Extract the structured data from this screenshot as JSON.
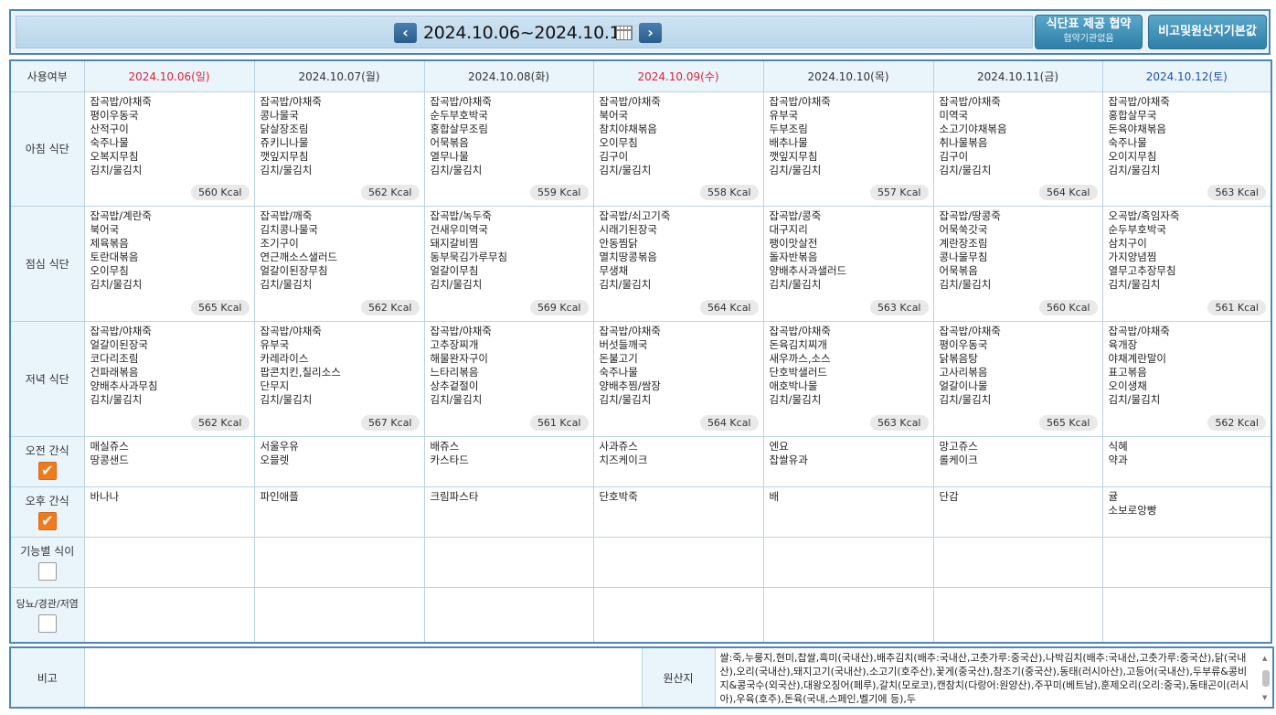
{
  "header": {
    "date_range": "2024.10.06~2024.10.12",
    "prev_label": "‹",
    "next_label": "›",
    "btn_agreement_l1": "식단표 제공 협약",
    "btn_agreement_l2": "협약기관없음",
    "btn_remarks": "비고및원산지기본값"
  },
  "table": {
    "corner": "사용여부",
    "days": [
      {
        "date": "2024.10.06(일)",
        "kind": "sun"
      },
      {
        "date": "2024.10.07(월)",
        "kind": "wd"
      },
      {
        "date": "2024.10.08(화)",
        "kind": "wd"
      },
      {
        "date": "2024.10.09(수)",
        "kind": "hol"
      },
      {
        "date": "2024.10.10(목)",
        "kind": "wd"
      },
      {
        "date": "2024.10.11(금)",
        "kind": "wd"
      },
      {
        "date": "2024.10.12(토)",
        "kind": "sat"
      }
    ],
    "rows": [
      {
        "label": "아침 식단",
        "checkbox": null,
        "cells": [
          {
            "items": [
              "잡곡밥/야채죽",
              "평이우동국",
              "산적구이",
              "숙주나물",
              "오복지무침",
              "김치/물김치"
            ],
            "kcal": "560 Kcal"
          },
          {
            "items": [
              "잡곡밥/야채죽",
              "콩나물국",
              "닭살장조림",
              "쥬키니나물",
              "깻잎지무침",
              "김치/물김치"
            ],
            "kcal": "562 Kcal"
          },
          {
            "items": [
              "잡곡밥/야채죽",
              "순두부호박국",
              "홍합살무조림",
              "어묵볶음",
              "열무나물",
              "김치/물김치"
            ],
            "kcal": "559 Kcal"
          },
          {
            "items": [
              "잡곡밥/야채죽",
              "북어국",
              "참치야채볶음",
              "오이무침",
              "김구이",
              "김치/물김치"
            ],
            "kcal": "558 Kcal"
          },
          {
            "items": [
              "잡곡밥/야채죽",
              "유부국",
              "두부조림",
              "배추나물",
              "깻잎지무침",
              "김치/물김치"
            ],
            "kcal": "557 Kcal"
          },
          {
            "items": [
              "잡곡밥/야채죽",
              "미역국",
              "소고기야채볶음",
              "취나물볶음",
              "김구이",
              "김치/물김치"
            ],
            "kcal": "564 Kcal"
          },
          {
            "items": [
              "잡곡밥/야채죽",
              "홍합살무국",
              "돈육야채볶음",
              "숙주나물",
              "오이지무침",
              "김치/물김치"
            ],
            "kcal": "563 Kcal"
          }
        ]
      },
      {
        "label": "점심 식단",
        "checkbox": null,
        "cells": [
          {
            "items": [
              "잡곡밥/계란죽",
              "북어국",
              "제육볶음",
              "토란대볶음",
              "오이무침",
              "김치/물김치"
            ],
            "kcal": "565 Kcal"
          },
          {
            "items": [
              "잡곡밥/깨죽",
              "김치콩나물국",
              "조기구이",
              "연근깨소스샐러드",
              "얼갈이된장무침",
              "김치/물김치"
            ],
            "kcal": "562 Kcal"
          },
          {
            "items": [
              "잡곡밥/녹두죽",
              "건새우미역국",
              "돼지갈비찜",
              "동부묵김가루무침",
              "얼갈이무침",
              "김치/물김치"
            ],
            "kcal": "569 Kcal"
          },
          {
            "items": [
              "잡곡밥/쇠고기죽",
              "시래기된장국",
              "안동찜닭",
              "멸치땅콩볶음",
              "무생채",
              "김치/물김치"
            ],
            "kcal": "564 Kcal"
          },
          {
            "items": [
              "잡곡밥/콩죽",
              "대구지리",
              "팽이맛살전",
              "돌자반볶음",
              "양배추사과샐러드",
              "김치/물김치"
            ],
            "kcal": "563 Kcal"
          },
          {
            "items": [
              "잡곡밥/땅콩죽",
              "어묵쑥갓국",
              "계란장조림",
              "콩나물무침",
              "어묵볶음",
              "김치/물김치"
            ],
            "kcal": "560 Kcal"
          },
          {
            "items": [
              "오곡밥/흑임자죽",
              "순두부호박국",
              "삼치구이",
              "가지양념찜",
              "열무고추장무침",
              "김치/물김치"
            ],
            "kcal": "561 Kcal"
          }
        ]
      },
      {
        "label": "저녁 식단",
        "checkbox": null,
        "cells": [
          {
            "items": [
              "잡곡밥/야채죽",
              "얼갈이된장국",
              "코다리조림",
              "건파래볶음",
              "양배추사과무침",
              "김치/물김치"
            ],
            "kcal": "562 Kcal"
          },
          {
            "items": [
              "잡곡밥/야채죽",
              "유부국",
              "카레라이스",
              "팝콘치킨,칠리소스",
              "단무지",
              "김치/물김치"
            ],
            "kcal": "567 Kcal"
          },
          {
            "items": [
              "잡곡밥/야채죽",
              "고추장찌개",
              "해물완자구이",
              "느타리볶음",
              "상추겉절이",
              "김치/물김치"
            ],
            "kcal": "561 Kcal"
          },
          {
            "items": [
              "잡곡밥/야채죽",
              "버섯들깨국",
              "돈불고기",
              "숙주나물",
              "양배추찜/쌈장",
              "김치/물김치"
            ],
            "kcal": "564 Kcal"
          },
          {
            "items": [
              "잡곡밥/야채죽",
              "돈육김치찌개",
              "새우까스,소스",
              "단호박샐러드",
              "애호박나물",
              "김치/물김치"
            ],
            "kcal": "563 Kcal"
          },
          {
            "items": [
              "잡곡밥/야채죽",
              "평이우동국",
              "닭볶음탕",
              "고사리볶음",
              "얼갈이나물",
              "김치/물김치"
            ],
            "kcal": "565 Kcal"
          },
          {
            "items": [
              "잡곡밥/야채죽",
              "육개장",
              "야채계란말이",
              "표고볶음",
              "오이생채",
              "김치/물김치"
            ],
            "kcal": "562 Kcal"
          }
        ]
      },
      {
        "label": "오전 간식",
        "checkbox": "on",
        "cells": [
          {
            "items": [
              "매실쥬스",
              "땅콩샌드"
            ],
            "kcal": ""
          },
          {
            "items": [
              "서울우유",
              "오믈렛"
            ],
            "kcal": ""
          },
          {
            "items": [
              "배쥬스",
              "카스타드"
            ],
            "kcal": ""
          },
          {
            "items": [
              "사과쥬스",
              "치즈케이크"
            ],
            "kcal": ""
          },
          {
            "items": [
              "엔요",
              "찹쌀유과"
            ],
            "kcal": ""
          },
          {
            "items": [
              "망고쥬스",
              "롤케이크"
            ],
            "kcal": ""
          },
          {
            "items": [
              "식혜",
              "약과"
            ],
            "kcal": ""
          }
        ]
      },
      {
        "label": "오후 간식",
        "checkbox": "on",
        "cells": [
          {
            "items": [
              "바나나"
            ],
            "kcal": ""
          },
          {
            "items": [
              "파인애플"
            ],
            "kcal": ""
          },
          {
            "items": [
              "크림파스타"
            ],
            "kcal": ""
          },
          {
            "items": [
              "단호박죽"
            ],
            "kcal": ""
          },
          {
            "items": [
              "배"
            ],
            "kcal": ""
          },
          {
            "items": [
              "단감"
            ],
            "kcal": ""
          },
          {
            "items": [
              "귤",
              "소보로앙빵"
            ],
            "kcal": ""
          }
        ]
      },
      {
        "label": "기능별 식이",
        "checkbox": "off",
        "cells": [
          {
            "items": [],
            "kcal": ""
          },
          {
            "items": [],
            "kcal": ""
          },
          {
            "items": [],
            "kcal": ""
          },
          {
            "items": [],
            "kcal": ""
          },
          {
            "items": [],
            "kcal": ""
          },
          {
            "items": [],
            "kcal": ""
          },
          {
            "items": [],
            "kcal": ""
          }
        ]
      },
      {
        "label": "당뇨/경관/저염",
        "checkbox": "off",
        "cells": [
          {
            "items": [],
            "kcal": ""
          },
          {
            "items": [],
            "kcal": ""
          },
          {
            "items": [],
            "kcal": ""
          },
          {
            "items": [],
            "kcal": ""
          },
          {
            "items": [],
            "kcal": ""
          },
          {
            "items": [],
            "kcal": ""
          },
          {
            "items": [],
            "kcal": ""
          }
        ]
      }
    ]
  },
  "footer": {
    "remarks_label": "비고",
    "remarks_value": "",
    "origin_label": "원산지",
    "origin_text": "쌀:죽,누룽지,현미,찹쌀,흑미(국내산),배추김치(배추:국내산,고춧가루:중국산),나박김치(배추:국내산,고춧가루:중국산),닭(국내산),오리(국내산),돼지고기(국내산),소고기(호주산),꽃게(중국산),참조기(중국산),동태(러시아산),고등어(국내산),두부류&콩비지&콩국수(외국산),대왕오징어(페루),갈치(모로코),캔참치(다랑어:원양산),주꾸미(베트남),훈제오리(오리:중국),동태곤이(러시아),우육(호주),돈육(국내,스페인,벨기에 등),두"
  },
  "colors": {
    "border": "#4f86b8",
    "header_bg": "#eaf4fb",
    "sunday": "#e0203a",
    "saturday": "#1f4fa8",
    "checkbox_on": "#f07b1f"
  }
}
